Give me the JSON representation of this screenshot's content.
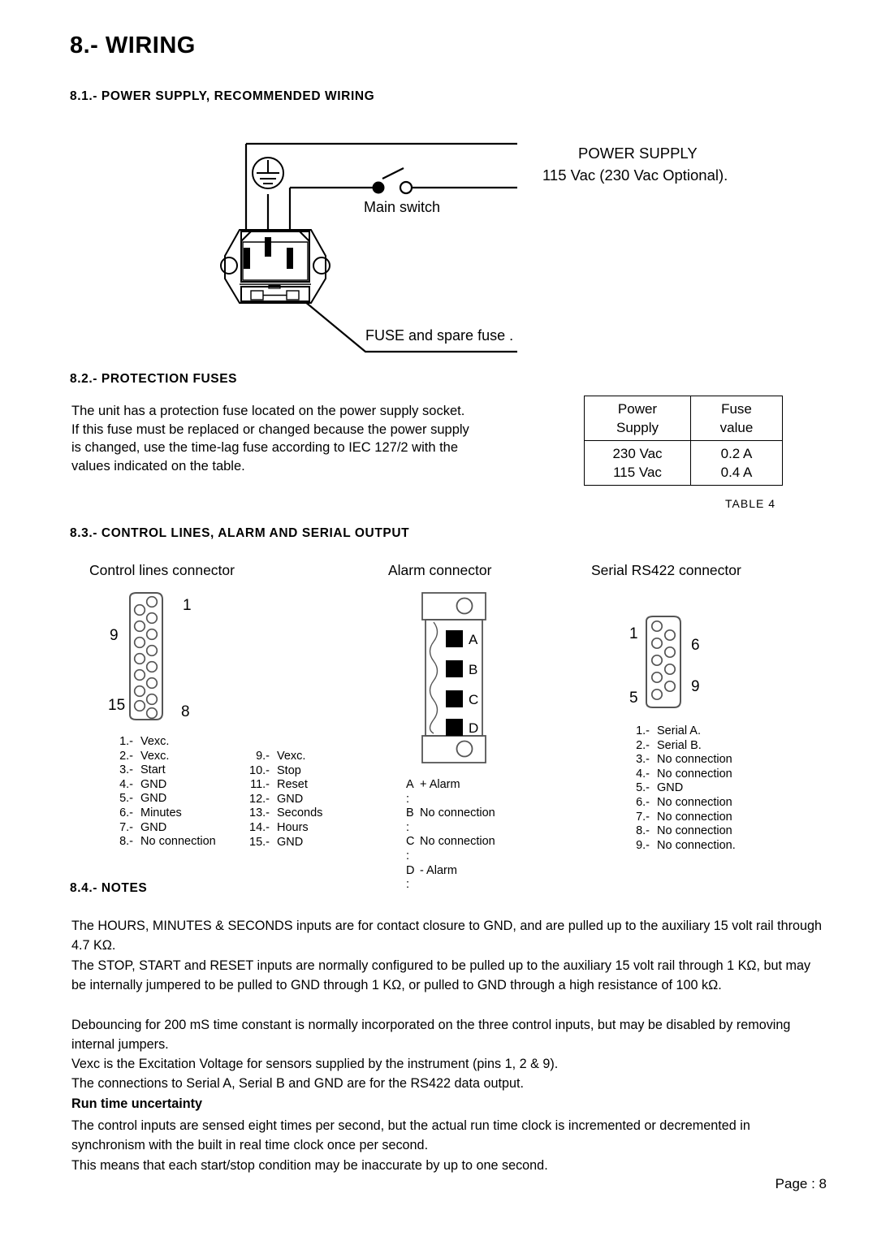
{
  "document": {
    "title": "8.- WIRING",
    "page_label": "Page : 8"
  },
  "sections": {
    "s81": "8.1.- POWER SUPPLY, RECOMMENDED WIRING",
    "s82": "8.2.- PROTECTION FUSES",
    "s83": "8.3.- CONTROL LINES, ALARM AND SERIAL OUTPUT",
    "s84": "8.4.- NOTES"
  },
  "power_supply_diagram": {
    "main_switch_label": "Main switch",
    "fuse_label": "FUSE and spare fuse .",
    "supply_line1": "POWER SUPPLY",
    "supply_line2": "115 Vac (230 Vac Optional)."
  },
  "protection_fuses": {
    "paragraph": "The unit has a protection fuse located on the power supply socket.\nIf this fuse must be replaced or changed because the power supply\nis changed, use the time-lag fuse according to IEC 127/2 with the\nvalues indicated on the table.",
    "table": {
      "caption": "TABLE 4",
      "headers": [
        "Power\nSupply",
        "Fuse\nvalue"
      ],
      "rows": [
        [
          "230 Vac\n115 Vac",
          "0.2 A\n0.4 A"
        ]
      ]
    }
  },
  "connectors": {
    "control": {
      "title": "Control lines connector",
      "corner_labels": {
        "top_left": "9",
        "top_right": "1",
        "bottom_left": "15",
        "bottom_right": "8"
      },
      "pins_col1": [
        {
          "num": "1.-",
          "name": "Vexc."
        },
        {
          "num": "2.-",
          "name": "Vexc."
        },
        {
          "num": "3.-",
          "name": "Start"
        },
        {
          "num": "4.-",
          "name": "GND"
        },
        {
          "num": "5.-",
          "name": "GND"
        },
        {
          "num": "6.-",
          "name": "Minutes"
        },
        {
          "num": "7.-",
          "name": "GND"
        },
        {
          "num": "8.-",
          "name": "No connection"
        }
      ],
      "pins_col2": [
        {
          "num": "9.-",
          "name": "Vexc."
        },
        {
          "num": "10.-",
          "name": "Stop"
        },
        {
          "num": "11.-",
          "name": "Reset"
        },
        {
          "num": "12.-",
          "name": "GND"
        },
        {
          "num": "13.-",
          "name": "Seconds"
        },
        {
          "num": "14.-",
          "name": "Hours"
        },
        {
          "num": "15.-",
          "name": "GND"
        }
      ]
    },
    "alarm": {
      "title": "Alarm connector",
      "terminal_labels": [
        "A",
        "B",
        "C",
        "D"
      ],
      "pins": [
        {
          "num": "A :",
          "name": "+ Alarm"
        },
        {
          "num": "B :",
          "name": "No connection"
        },
        {
          "num": "C :",
          "name": "No connection"
        },
        {
          "num": "D :",
          "name": "- Alarm"
        }
      ]
    },
    "serial": {
      "title": "Serial RS422 connector",
      "corner_labels": {
        "top_left": "1",
        "top_right": "6",
        "bottom_left": "5",
        "bottom_right": "9"
      },
      "pins": [
        {
          "num": "1.-",
          "name": "Serial A."
        },
        {
          "num": "2.-",
          "name": "Serial B."
        },
        {
          "num": "3.-",
          "name": "No connection"
        },
        {
          "num": "4.-",
          "name": "No connection"
        },
        {
          "num": "5.-",
          "name": "GND"
        },
        {
          "num": "6.-",
          "name": "No connection"
        },
        {
          "num": "7.-",
          "name": "No connection"
        },
        {
          "num": "8.-",
          "name": "No connection"
        },
        {
          "num": "9.-",
          "name": "No connection."
        }
      ]
    }
  },
  "notes": {
    "n1": "The HOURS, MINUTES & SECONDS inputs are for contact closure to GND, and are pulled up to the auxiliary 15 volt rail through 4.7 KΩ.",
    "n2": "The STOP, START and RESET inputs are normally configured to be pulled up to the auxiliary 15 volt rail through 1 KΩ,  but may be internally jumpered to be pulled to GND through 1 KΩ, or pulled to GND through a high resistance of 100 kΩ.",
    "n3": "Debouncing for 200 mS time constant is normally incorporated on the three control inputs, but may be disabled by removing internal jumpers.",
    "n4": "Vexc is the Excitation Voltage for sensors supplied by the instrument (pins 1, 2 & 9).",
    "n5": "The connections to Serial A, Serial B and GND are for the RS422 data output.",
    "run_time_title": "Run time uncertainty",
    "rt1": "The control inputs are sensed eight times per second, but the actual run time clock is incremented or decremented in synchronism with the built in real time clock once per second.",
    "rt2": "This means that each start/stop condition may be inaccurate by up to one second."
  }
}
